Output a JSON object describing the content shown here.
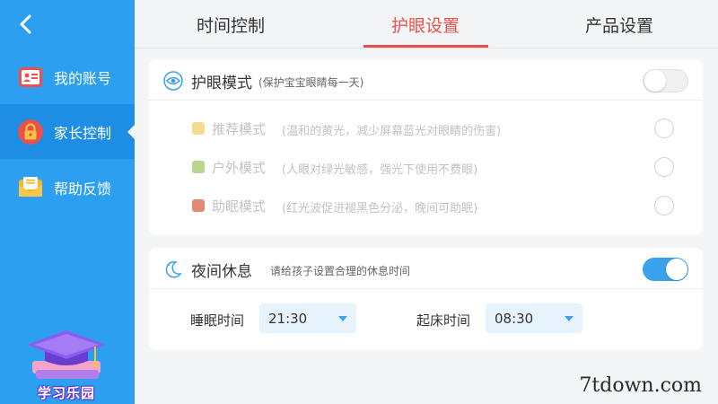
{
  "sidebar": {
    "items": [
      {
        "label": "我的账号",
        "icon": "account-card-icon"
      },
      {
        "label": "家长控制",
        "icon": "lock-icon"
      },
      {
        "label": "帮助反馈",
        "icon": "mail-icon"
      }
    ],
    "logo_text": "学习乐园"
  },
  "tabs": [
    {
      "label": "时间控制"
    },
    {
      "label": "护眼设置"
    },
    {
      "label": "产品设置"
    }
  ],
  "eye_card": {
    "title": "护眼模式",
    "subtitle": "(保护宝宝眼睛每一天)",
    "enabled": false,
    "modes": [
      {
        "name": "推荐模式",
        "desc": "(温和的黄光，减少屏幕蓝光对眼睛的伤害)",
        "color": "#f3dc8e"
      },
      {
        "name": "户外模式",
        "desc": "(人眼对绿光敏感，强光下使用不费眼)",
        "color": "#b9d58f"
      },
      {
        "name": "助眠模式",
        "desc": "(红光波促进褪黑色分泌，晚间可助眠)",
        "color": "#e08a74"
      }
    ]
  },
  "night_card": {
    "title": "夜间休息",
    "subtitle": "请给孩子设置合理的休息时间",
    "enabled": true,
    "sleep_label": "睡眠时间",
    "sleep_value": "21:30",
    "wake_label": "起床时间",
    "wake_value": "08:30"
  },
  "colors": {
    "sidebar": "#2d9ff0",
    "accent_red": "#e8524a",
    "toggle_on": "#3aa1ec"
  },
  "watermark": "7tdown.com"
}
